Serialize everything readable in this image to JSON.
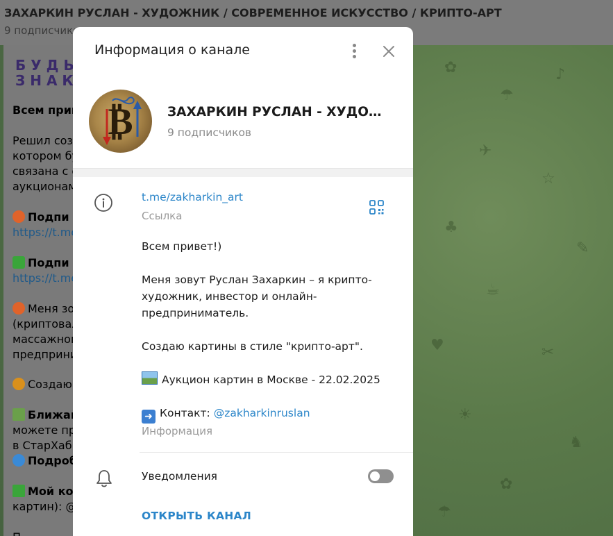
{
  "channel_header": {
    "title": "ЗАХАРКИН РУСЛАН - ХУДОЖНИК / СОВРЕМЕННОЕ ИСКУССТВО / КРИПТО-АРТ",
    "subscribers": "9 подписчиков"
  },
  "background_message": {
    "promo_line1": "БУДЬ",
    "promo_line2": "ЗНАК",
    "lines": [
      "Всем прив",
      "Решил созд",
      "котором бу",
      "связана с с",
      "аукционам",
      "Подпи",
      "https://t.me",
      "Подпи",
      "https://t.me",
      "Меня зо",
      "(криптовал",
      "массажного",
      "предприни",
      "Создаю",
      "Ближай",
      "можете при",
      "в СтарХаб н",
      "Подроб",
      "Мой ко",
      "картин): @z",
      "П"
    ]
  },
  "dialog": {
    "title": "Информация о канале",
    "channel_name": "ЗАХАРКИН РУСЛАН - ХУДОЖНИК / СОВРЕМЕННОЕ ИСКУССТВО / КРИПТО-АРТ",
    "subscribers": "9 подписчиков",
    "link": "t.me/zakharkin_art",
    "link_caption": "Ссылка",
    "description": {
      "greeting": "Всем привет!)",
      "intro_1": "Меня зовут Руслан Захаркин – я крипто-",
      "intro_2": "художник, инвестор и онлайн-",
      "intro_3": "предприниматель.",
      "style": "Создаю картины в стиле \"крипто-арт\".",
      "auction": "Аукцион картин в Москве - 22.02.2025",
      "contact_label": "Контакт: ",
      "contact_handle": "@zakharkinruslan"
    },
    "description_caption": "Информация",
    "notifications_label": "Уведомления",
    "notifications_enabled": false,
    "open_channel": "ОТКРЫТЬ КАНАЛ"
  },
  "colors": {
    "accent": "#2c86c9",
    "overlay": "#7b7b7b"
  }
}
